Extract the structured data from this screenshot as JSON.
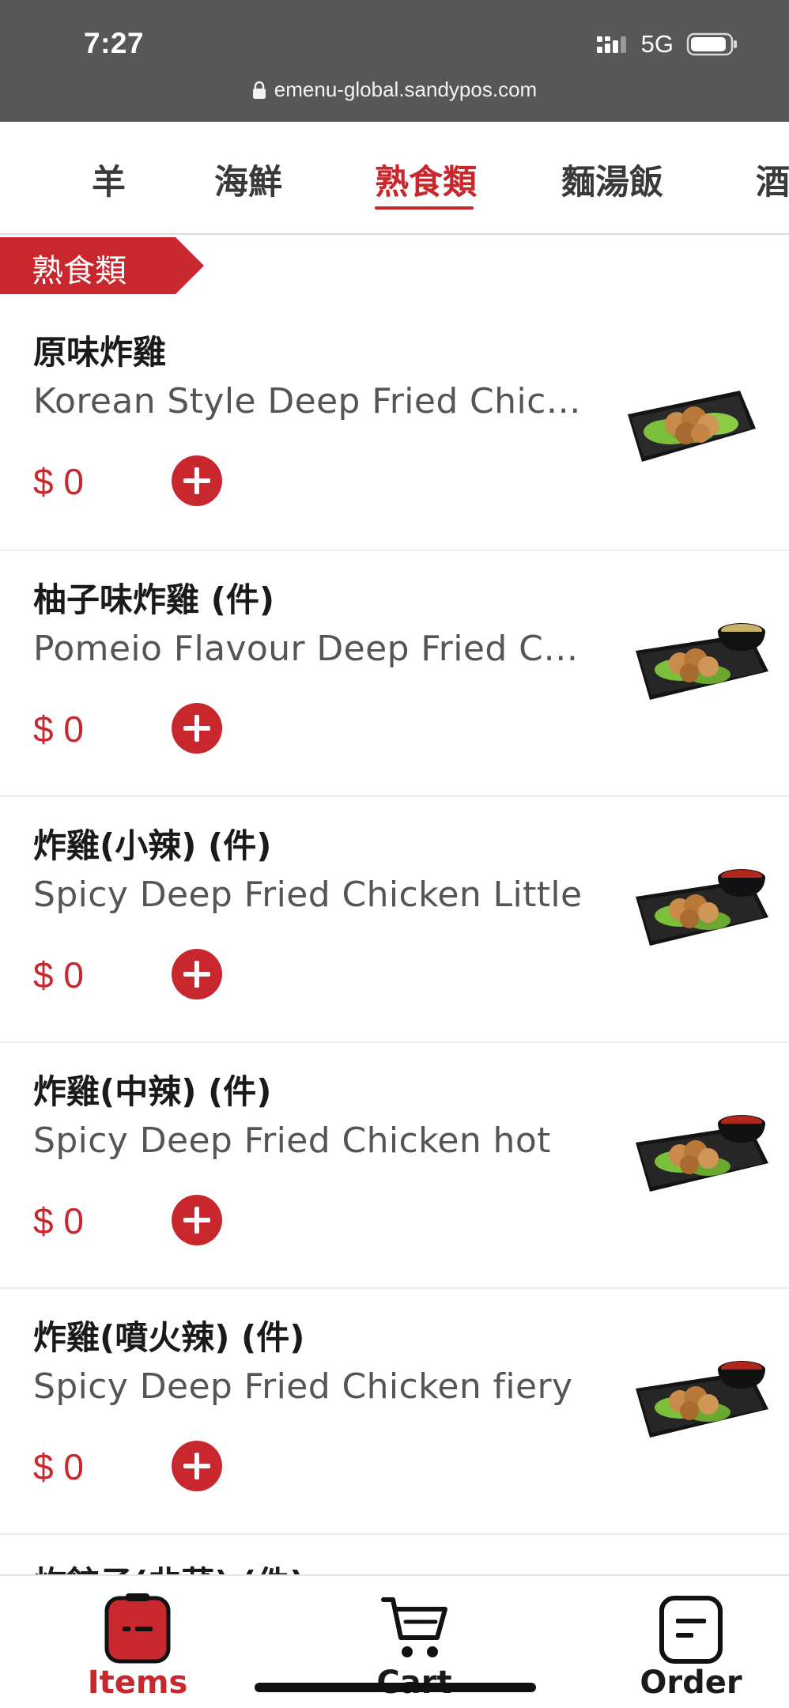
{
  "status_bar": {
    "time": "7:27",
    "network": "5G",
    "url": "emenu-global.sandypos.com"
  },
  "category_tabs": [
    {
      "label": "羊",
      "active": false
    },
    {
      "label": "海鮮",
      "active": false
    },
    {
      "label": "熟食類",
      "active": true
    },
    {
      "label": "麵湯飯",
      "active": false
    },
    {
      "label": "酒",
      "active": false
    }
  ],
  "section": {
    "title": "熟食類"
  },
  "menu_items": [
    {
      "name": "原味炸雞",
      "description": "Korean Style Deep Fried Chic…",
      "price": "$ 0",
      "image": "fried-chicken-plate"
    },
    {
      "name": "柚子味炸雞 (件)",
      "description": "Pomeio Flavour Deep Fried C…",
      "price": "$ 0",
      "image": "fried-chicken-with-sauce"
    },
    {
      "name": "炸雞(小辣) (件)",
      "description": "Spicy Deep Fried Chicken Little",
      "price": "$ 0",
      "image": "fried-chicken-with-red-sauce"
    },
    {
      "name": "炸雞(中辣) (件)",
      "description": "Spicy Deep Fried Chicken hot",
      "price": "$ 0",
      "image": "fried-chicken-with-red-sauce"
    },
    {
      "name": "炸雞(噴火辣) (件)",
      "description": "Spicy Deep Fried Chicken fiery",
      "price": "$ 0",
      "image": "fried-chicken-with-red-sauce"
    },
    {
      "name": "炸餃子(韭菜) (件)",
      "description": "",
      "price": "",
      "image": ""
    }
  ],
  "bottom_nav": [
    {
      "label": "Items",
      "icon": "items-icon",
      "active": true
    },
    {
      "label": "Cart",
      "icon": "cart-icon",
      "active": false
    },
    {
      "label": "Order",
      "icon": "order-icon",
      "active": false
    }
  ],
  "colors": {
    "accent": "#c8282d",
    "status_bar": "#575757",
    "text_dark": "#1a1a1a",
    "text_muted": "#555555"
  }
}
